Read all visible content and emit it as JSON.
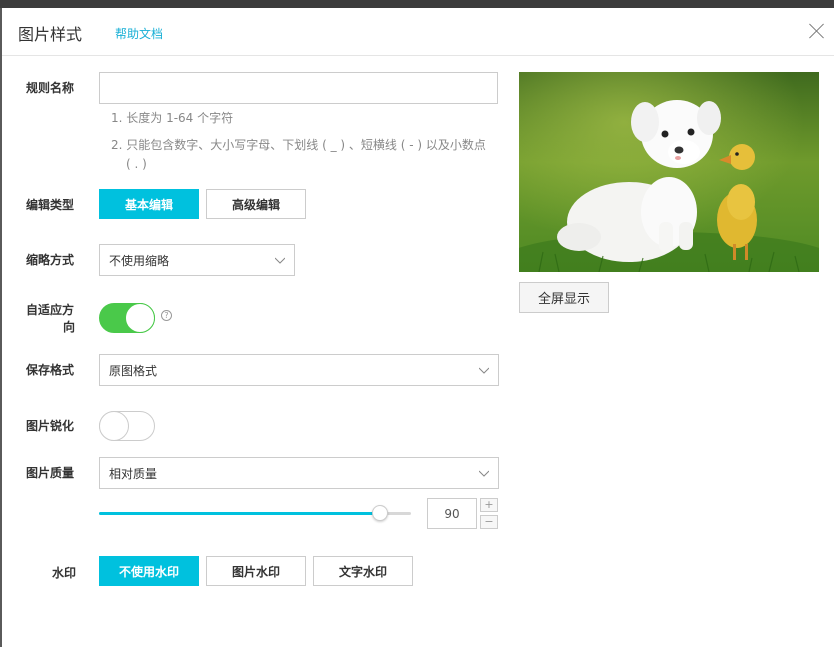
{
  "dialog": {
    "title": "图片样式",
    "help_link": "帮助文档"
  },
  "form": {
    "rule_name": {
      "label": "规则名称",
      "value": "",
      "hints": [
        "1. 长度为 1-64 个字符",
        "2. 只能包含数字、大小写字母、下划线 ( _ ) 、短横线 ( - ) 以及小数点",
        "( . )"
      ]
    },
    "edit_type": {
      "label": "编辑类型",
      "options": [
        "基本编辑",
        "高级编辑"
      ],
      "selected": "基本编辑"
    },
    "thumbnail": {
      "label": "缩略方式",
      "value": "不使用缩略"
    },
    "adaptive": {
      "label_line1": "自适应方",
      "label_line2": "向",
      "on": true,
      "help": "?"
    },
    "save_format": {
      "label": "保存格式",
      "value": "原图格式"
    },
    "sharpen": {
      "label": "图片锐化",
      "on": false
    },
    "quality": {
      "label": "图片质量",
      "value": "相对质量",
      "slider_value": 90,
      "slider_max": 100,
      "number": "90",
      "plus": "+",
      "minus": "−"
    },
    "watermark": {
      "label": "水印",
      "options": [
        "不使用水印",
        "图片水印",
        "文字水印"
      ],
      "selected": "不使用水印"
    }
  },
  "preview": {
    "fullscreen_label": "全屏显示"
  },
  "colors": {
    "accent": "#00c1de",
    "toggle_on": "#4ac94a",
    "link": "#1ab0d6"
  }
}
